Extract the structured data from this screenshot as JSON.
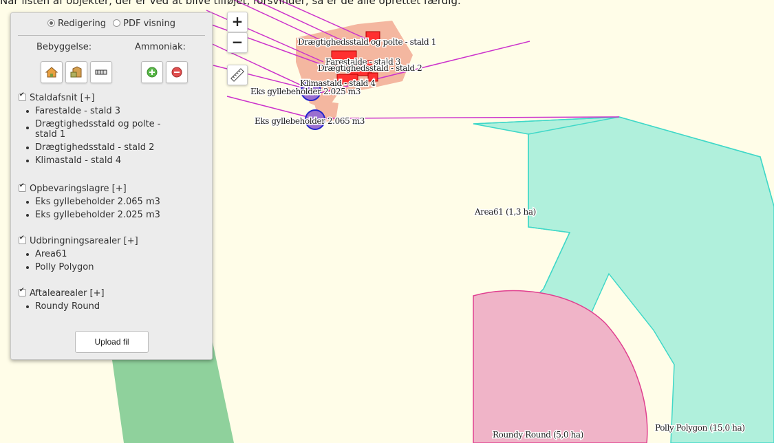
{
  "top_message": "Når listen af objekter, der er ved at blive tilføjet, forsvinder, så er de alle oprettet færdig.",
  "zoom": {
    "in_label": "+",
    "out_label": "−"
  },
  "panel": {
    "mode_options": [
      "Redigering",
      "PDF visning"
    ],
    "selected_mode": "Redigering",
    "bebyggelse_label": "Bebyggelse:",
    "ammoniak_label": "Ammoniak:",
    "groups": [
      {
        "title": "Staldafsnit [+]",
        "items": [
          "Farestalde - stald 3",
          "Drægtighedsstald og polte -",
          "stald 1",
          "Drægtighedsstald - stald 2",
          "Klimastald - stald 4"
        ]
      },
      {
        "title": "Opbevaringslagre [+]",
        "items": [
          "Eks gyllebeholder 2.065 m3",
          "Eks gyllebeholder 2.025 m3"
        ]
      },
      {
        "title": "Udbringningsarealer [+]",
        "items": [
          "Area61",
          "Polly Polygon"
        ]
      },
      {
        "title": "Aftalearealer [+]",
        "items": [
          "Roundy Round"
        ]
      }
    ],
    "upload_label": "Upload fil"
  },
  "map_labels": {
    "draegt_polte": "Drægtighedsstald og polte - stald 1",
    "farestalde": "Farestalde - stald 3",
    "draegt_2": "Drægtighedsstald - stald 2",
    "klimastald": "Klimastald - stald 4",
    "gylle_2025": "Eks gyllebeholder 2.025 m3",
    "gylle_2065": "Eks gyllebeholder 2.065 m3",
    "area61": "Area61 (1,3 ha)",
    "polly": "Polly Polygon (15,0 ha)",
    "roundy": "Roundy Round (5,0 ha)"
  },
  "colors": {
    "map_background": "#fffde8",
    "green_field": "#8fd19c",
    "teal_area": "#b0f0dc",
    "teal_border": "#40d8c8",
    "pink_area": "#f0b4c8",
    "pink_border": "#e04090",
    "building": "#f4b7a0",
    "stald_fill": "#ff3030",
    "tank": "#9a6fd0",
    "magenta_line": "#cc33cc"
  }
}
